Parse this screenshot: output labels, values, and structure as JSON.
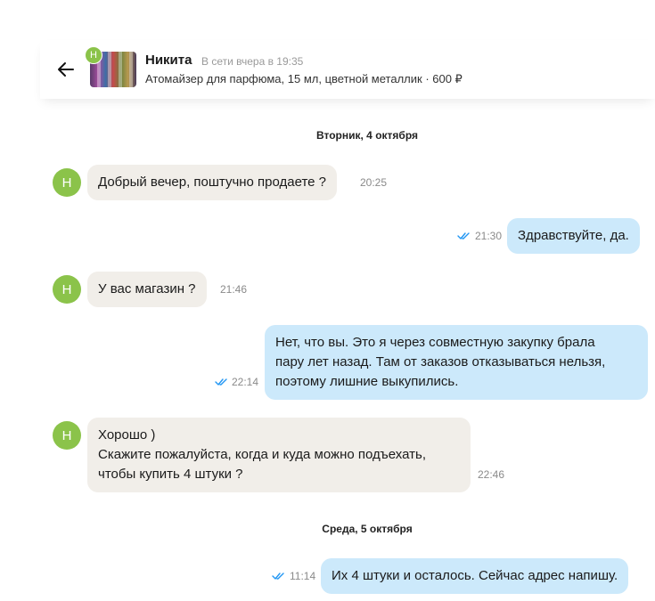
{
  "header": {
    "name": "Никита",
    "status": "В сети вчера в 19:35",
    "item": "Атомайзер для парфюма, 15 мл, цветной металлик · 600 ₽",
    "avatar_letter": "Н"
  },
  "dates": [
    "Вторник, 4 октября",
    "Среда, 5 октября"
  ],
  "messages": [
    {
      "direction": "in",
      "avatar": "Н",
      "text": "Добрый вечер, поштучно продаете ?",
      "time": "20:25"
    },
    {
      "direction": "out",
      "text": "Здравствуйте, да.",
      "time": "21:30",
      "status": "read"
    },
    {
      "direction": "in",
      "avatar": "Н",
      "text": "У вас магазин ?",
      "time": "21:46"
    },
    {
      "direction": "out",
      "text": "Нет, что вы. Это я через совместную закупку брала\nпару лет назад. Там от заказов отказываться нельзя,\nпоэтому лишние выкупились.",
      "time": "22:14",
      "status": "read"
    },
    {
      "direction": "in",
      "avatar": "Н",
      "text": "Хорошо )\nСкажите пожалуйста, когда и куда можно подъехать,\nчтобы купить 4 штуки ?",
      "time": "22:46"
    },
    {
      "direction": "out",
      "text": "Их 4 штуки и осталось. Сейчас адрес напишу.",
      "time": "11:14",
      "status": "read"
    }
  ],
  "colors": {
    "incoming_bubble": "#f1eee9",
    "outgoing_bubble": "#cce9fb",
    "avatar": "#8bc34a",
    "read_check": "#2196f3"
  },
  "icons": {
    "back": "arrow-left-icon",
    "read": "double-check-icon"
  }
}
